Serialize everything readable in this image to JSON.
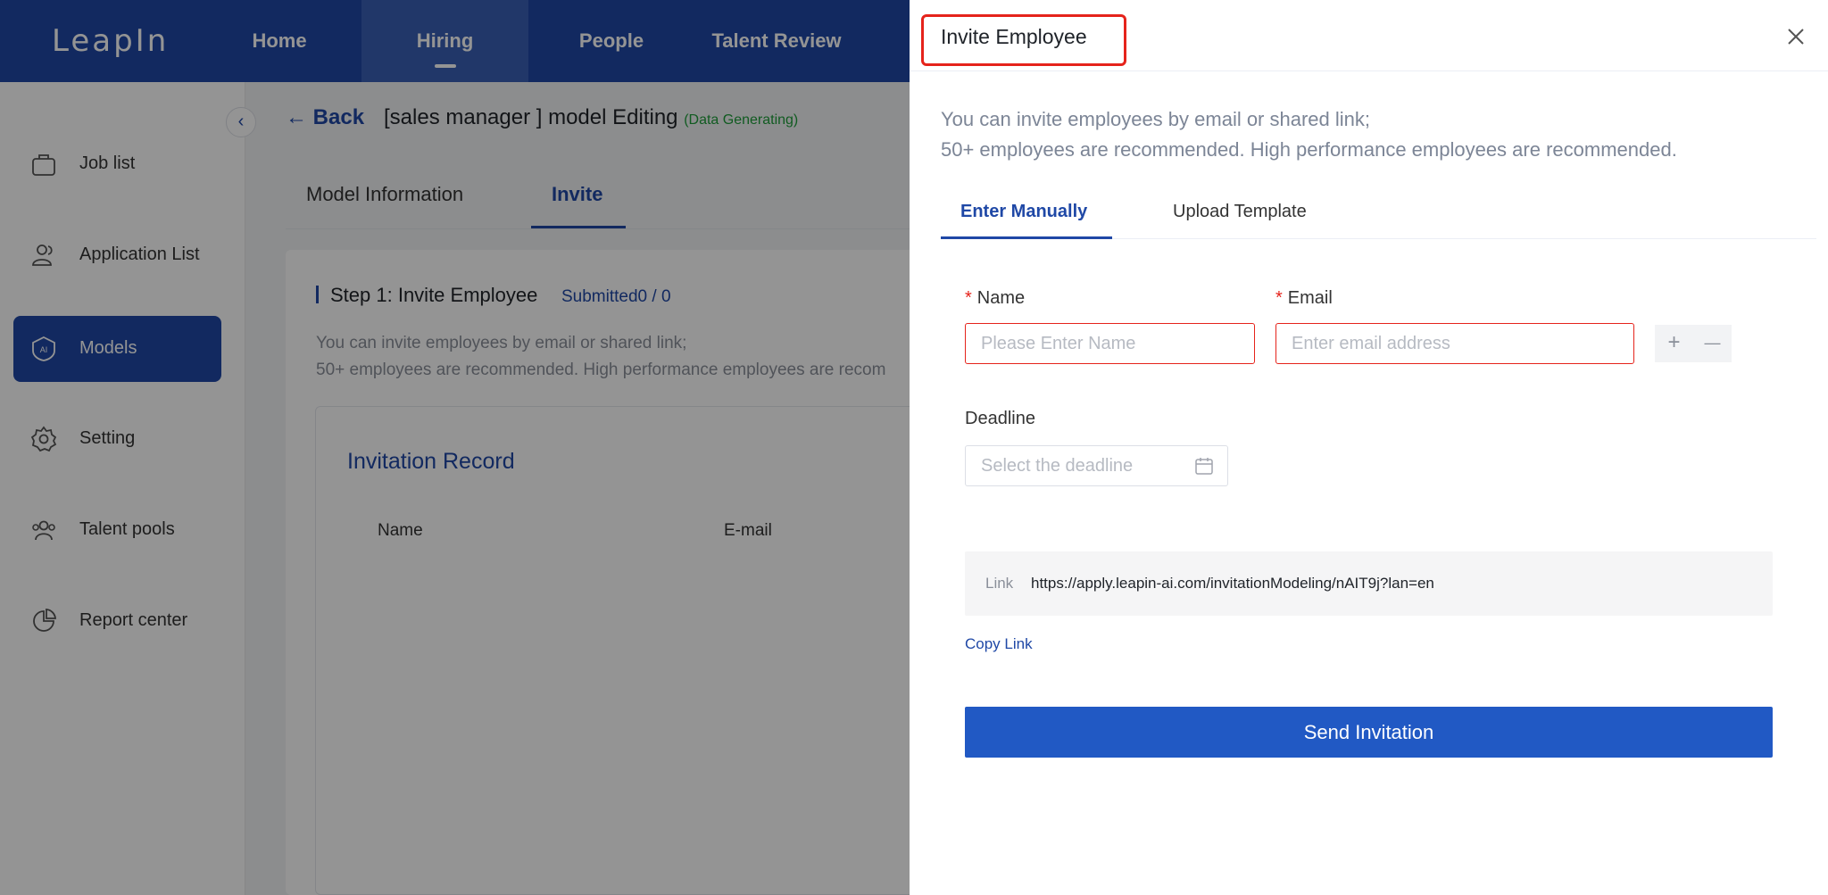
{
  "app": {
    "logo": "LeapIn",
    "nav": [
      {
        "label": "Home"
      },
      {
        "label": "Hiring"
      },
      {
        "label": "People"
      },
      {
        "label": "Talent Review"
      }
    ]
  },
  "sidebar": {
    "items": [
      {
        "label": "Job list",
        "icon": "briefcase-icon"
      },
      {
        "label": "Application List",
        "icon": "users-icon"
      },
      {
        "label": "Models",
        "icon": "ai-shield-icon"
      },
      {
        "label": "Setting",
        "icon": "gear-icon"
      },
      {
        "label": "Talent pools",
        "icon": "group-icon"
      },
      {
        "label": "Report center",
        "icon": "pie-chart-icon"
      }
    ],
    "active": "Models"
  },
  "page": {
    "back_label": "Back",
    "title": "[sales manager ] model Editing",
    "status_open": "(",
    "status": "Data Generating",
    "status_close": ")",
    "tabs": [
      {
        "label": "Model Information"
      },
      {
        "label": "Invite"
      }
    ],
    "step_title": "Step 1: Invite Employee",
    "step_count": "Submitted0 / 0",
    "step_desc_1": "You can invite employees by email or shared link;",
    "step_desc_2": "50+ employees are recommended. High performance employees are recom",
    "record_title": "Invitation Record",
    "columns": [
      "Name",
      "E-mail"
    ]
  },
  "drawer": {
    "title": "Invite Employee",
    "intro_1": "You can invite employees by email or shared link;",
    "intro_2": "50+ employees are recommended. High performance employees are recommended.",
    "tabs": [
      {
        "label": "Enter Manually"
      },
      {
        "label": "Upload Template"
      }
    ],
    "required_mark": "*",
    "name_label": "Name",
    "name_placeholder": "Please Enter Name",
    "email_label": "Email",
    "email_placeholder": "Enter email address",
    "add_symbol": "+",
    "remove_symbol": "—",
    "deadline_label": "Deadline",
    "deadline_placeholder": "Select the deadline",
    "link_label": "Link",
    "link_url": "https://apply.leapin-ai.com/invitationModeling/nAIT9j?lan=en",
    "copy_link": "Copy Link",
    "send_label": "Send Invitation"
  },
  "colors": {
    "brand": "#1f48a6",
    "primary_button": "#2159c4",
    "error": "#e5231b",
    "status_green": "#1e9e3a"
  }
}
